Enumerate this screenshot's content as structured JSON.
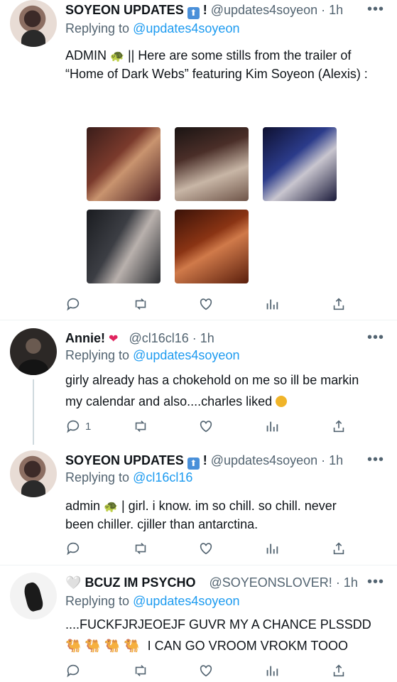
{
  "icons": {
    "reply": "reply-icon",
    "retweet": "retweet-icon",
    "like": "heart-icon",
    "analytics": "analytics-icon",
    "share": "share-icon",
    "more": "more-icon",
    "verified_box": "up-arrow-box-icon"
  },
  "colors": {
    "accent": "#1d9bf0",
    "muted": "#536471",
    "text": "#0f1419",
    "divider": "#eff3f4"
  },
  "tweets": [
    {
      "name": "SOYEON UPDATES",
      "badge": "⬆",
      "exclaim": "!",
      "handle": "@updates4soyeon",
      "time": "· 1h",
      "replying_prefix": "Replying to",
      "replying_to": "@updates4soyeon",
      "text_prefix": "ADMIN",
      "text_emoji": "🐢",
      "text_body": "|| Here are some stills from the trailer of “Home of Dark Webs” featuring Kim Soyeon (Alexis) :",
      "images": [
        "still-1",
        "still-2",
        "still-3",
        "still-4",
        "still-5"
      ],
      "replies": "",
      "retweets": "",
      "likes": ""
    },
    {
      "name": "Annie!",
      "name_emoji": "❤",
      "handle": "@cl16cl16",
      "time": "· 1h",
      "replying_prefix": "Replying to",
      "replying_to": "@updates4soyeon",
      "text_line1": "girly already has a chokehold on me so ill be markin",
      "text_line2": "my calendar and also....charles liked",
      "replies": "1",
      "retweets": "",
      "likes": ""
    },
    {
      "name": "SOYEON UPDATES",
      "badge": "⬆",
      "exclaim": "!",
      "handle": "@updates4soyeon",
      "time": "· 1h",
      "replying_prefix": "Replying to",
      "replying_to": "@cl16cl16",
      "text_prefix": "admin",
      "text_emoji": "🐢",
      "text_line1": "| girl. i know. im so chill. so chill. never",
      "text_line2": "been chiller. cjiller than antarctina.",
      "replies": "",
      "retweets": "",
      "likes": ""
    },
    {
      "name_emoji": "🤍",
      "name": "BCUZ IM PSYCHO",
      "handle": "@SOYEONSLOVER!",
      "time": "· 1h",
      "replying_prefix": "Replying to",
      "replying_to": "@updates4soyeon",
      "text_line1": "....FUCKFJRJEOEJF GUVR MY A CHANCE PLSSDD",
      "camels": "🐫 🐫 🐫 🐫",
      "text_line2": "I CAN GO VROOM VROKM TOOO",
      "replies": "",
      "retweets": "",
      "likes": ""
    }
  ]
}
